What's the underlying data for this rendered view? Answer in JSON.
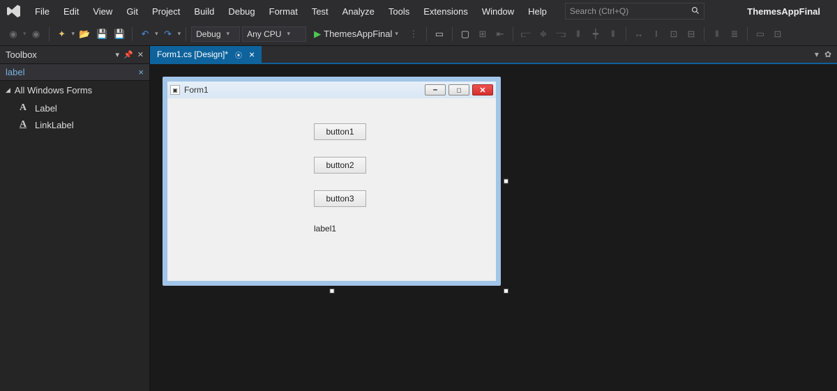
{
  "menubar": {
    "items": [
      "File",
      "Edit",
      "View",
      "Git",
      "Project",
      "Build",
      "Debug",
      "Format",
      "Test",
      "Analyze",
      "Tools",
      "Extensions",
      "Window",
      "Help"
    ],
    "search_placeholder": "Search (Ctrl+Q)",
    "project_name": "ThemesAppFinal"
  },
  "toolbar": {
    "config": "Debug",
    "platform": "Any CPU",
    "start_target": "ThemesAppFinal"
  },
  "toolbox": {
    "title": "Toolbox",
    "search_value": "label",
    "group": "All Windows Forms",
    "items": [
      {
        "label": "Label",
        "icon": "A",
        "link": false
      },
      {
        "label": "LinkLabel",
        "icon": "A",
        "link": true
      }
    ]
  },
  "editor": {
    "tab_title": "Form1.cs [Design]*"
  },
  "form": {
    "title": "Form1",
    "buttons": [
      "button1",
      "button2",
      "button3"
    ],
    "label": "label1"
  }
}
